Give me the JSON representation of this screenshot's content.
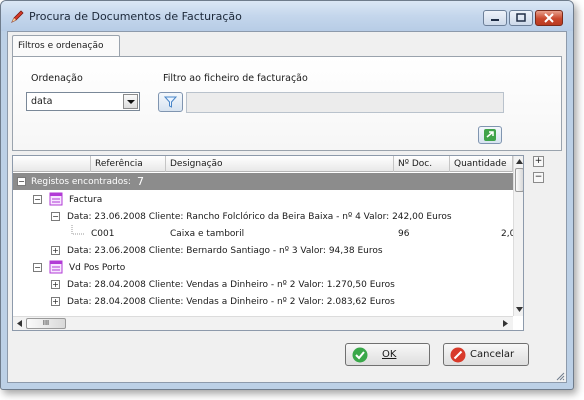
{
  "window": {
    "title": "Procura de Documentos de Facturação",
    "icon": "pencil-icon",
    "controls": [
      "minimize-icon",
      "maximize-icon",
      "close-icon"
    ]
  },
  "tab": {
    "label": "Filtros e ordenação"
  },
  "filters": {
    "ordering_label": "Ordenação",
    "ordering_value": "data",
    "file_filter_label": "Filtro ao ficheiro de facturação",
    "file_filter_value": ""
  },
  "grid": {
    "columns": [
      "Referência",
      "Designação",
      "Nº Doc.",
      "Quantidade"
    ],
    "group": {
      "label": "Registos encontrados:",
      "count": "7"
    },
    "rows": [
      {
        "level": 1,
        "toggle": "−",
        "icon": "document-type-icon",
        "text": "Factura"
      },
      {
        "level": 2,
        "toggle": "−",
        "text": "Data: 23.06.2008 Cliente: Rancho Folclórico da Beira Baixa - nº 4 Valor: 242,00 Euros"
      },
      {
        "level": 3,
        "ref": "C001",
        "designation": "Caixa e tamboril",
        "doc": "96",
        "qty": "2,0"
      },
      {
        "level": 2,
        "toggle": "+",
        "text": "Data: 23.06.2008 Cliente: Bernardo Santiago - nº 3 Valor: 94,38 Euros"
      },
      {
        "level": 1,
        "toggle": "−",
        "icon": "document-type-icon",
        "text": "Vd Pos Porto"
      },
      {
        "level": 2,
        "toggle": "+",
        "text": "Data: 28.04.2008 Cliente: Vendas a Dinheiro - nº 2 Valor: 1.270,50 Euros"
      },
      {
        "level": 2,
        "toggle": "+",
        "text": "Data: 28.04.2008 Cliente: Vendas a Dinheiro - nº 2 Valor: 2.083,62 Euros"
      }
    ],
    "hscroll_thumb": "III"
  },
  "buttons": {
    "ok": "OK",
    "cancel": "Cancelar"
  }
}
